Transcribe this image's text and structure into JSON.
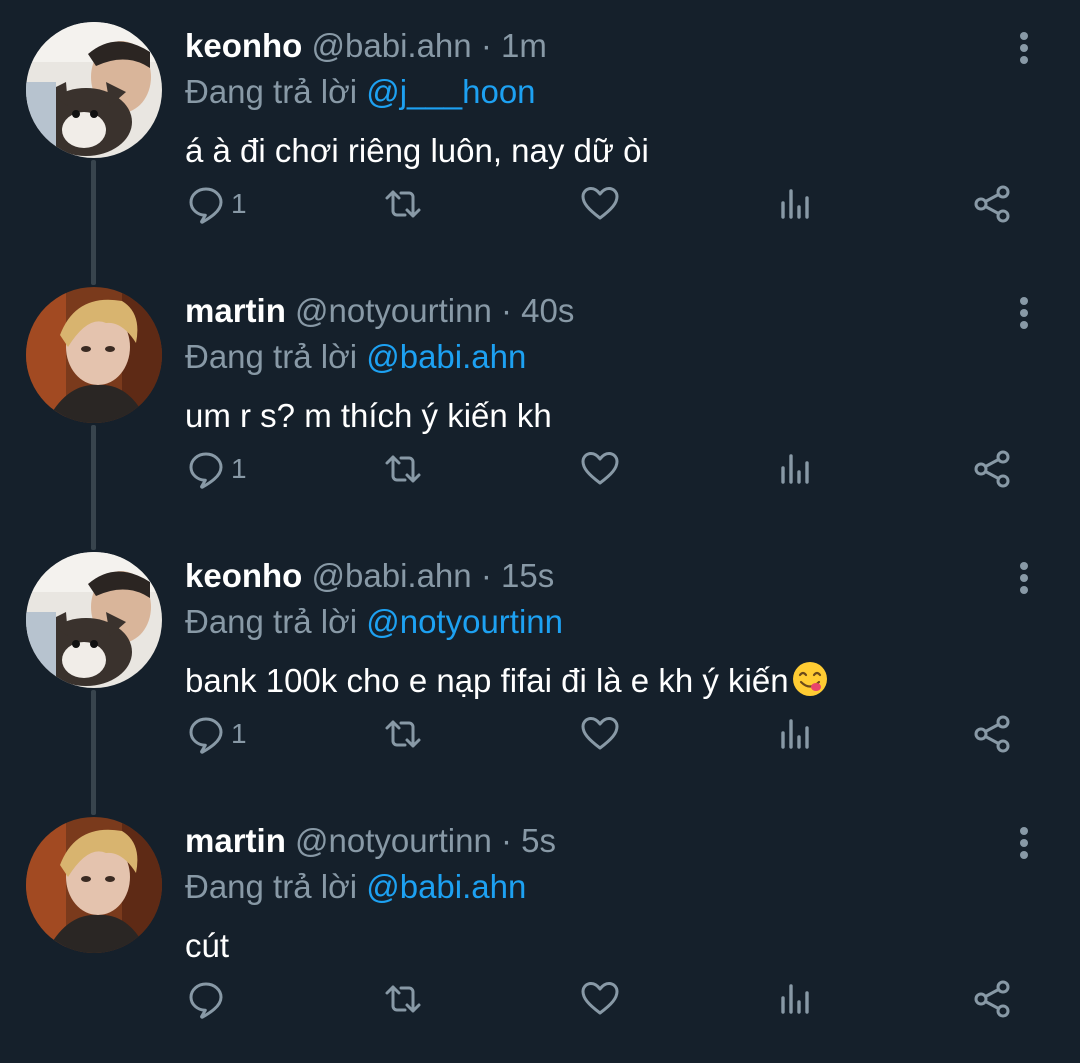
{
  "tweets": [
    {
      "name": "keonho",
      "handle": "@babi.ahn",
      "separator": "·",
      "time": "1m",
      "reply_prefix": "Đang trả lời",
      "reply_to": "@j___hoon",
      "text": "á à đi chơi riêng luôn, nay dữ òi",
      "reply_count": "1",
      "avatar": "keonho-avatar-with-dog"
    },
    {
      "name": "martin",
      "handle": "@notyourtinn",
      "separator": "·",
      "time": "40s",
      "reply_prefix": "Đang trả lời",
      "reply_to": "@babi.ahn",
      "text": "um r s? m thích ý kiến kh",
      "reply_count": "1",
      "avatar": "martin-avatar"
    },
    {
      "name": "keonho",
      "handle": "@babi.ahn",
      "separator": "·",
      "time": "15s",
      "reply_prefix": "Đang trả lời",
      "reply_to": "@notyourtinn",
      "text": "bank 100k cho e nạp fifai đi là e kh ý kiến",
      "emoji": "yum-face-emoji",
      "reply_count": "1",
      "avatar": "keonho-avatar-with-dog"
    },
    {
      "name": "martin",
      "handle": "@notyourtinn",
      "separator": "·",
      "time": "5s",
      "reply_prefix": "Đang trả lời",
      "reply_to": "@babi.ahn",
      "text": "cút",
      "reply_count": "",
      "avatar": "martin-avatar"
    }
  ],
  "colors": {
    "background": "#15202b",
    "muted": "#8899a6",
    "mention": "#1da1f2",
    "thread_line": "#38444d"
  },
  "icons": [
    "reply-icon",
    "retweet-icon",
    "like-icon",
    "analytics-icon",
    "share-icon",
    "more-options-icon"
  ]
}
